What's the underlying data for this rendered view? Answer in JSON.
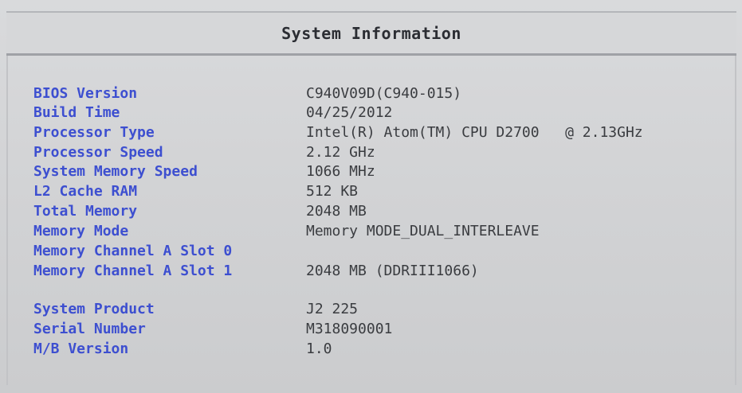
{
  "header": {
    "title": "System Information"
  },
  "info_rows": [
    {
      "label": "BIOS Version",
      "value": "C940V09D(C940-015)"
    },
    {
      "label": "Build Time",
      "value": "04/25/2012"
    },
    {
      "label": "Processor Type",
      "value": "Intel(R) Atom(TM) CPU D2700   @ 2.13GHz"
    },
    {
      "label": "Processor Speed",
      "value": "2.12 GHz"
    },
    {
      "label": "System Memory Speed",
      "value": "1066 MHz"
    },
    {
      "label": "L2 Cache RAM",
      "value": "512 KB"
    },
    {
      "label": "Total Memory",
      "value": "2048 MB"
    },
    {
      "label": "Memory Mode",
      "value": "Memory MODE_DUAL_INTERLEAVE"
    },
    {
      "label": "Memory Channel A Slot 0",
      "value": ""
    },
    {
      "label": "Memory Channel A Slot 1",
      "value": "2048 MB (DDRIII1066)"
    }
  ],
  "product_rows": [
    {
      "label": "System Product",
      "value": "J2 225"
    },
    {
      "label": "Serial Number",
      "value": "M318090001"
    },
    {
      "label": "M/B Version",
      "value": "1.0"
    }
  ],
  "colors": {
    "label_blue": "#3d4fd0",
    "value_gray": "#3a3c40",
    "background": "#d3d4d6"
  }
}
